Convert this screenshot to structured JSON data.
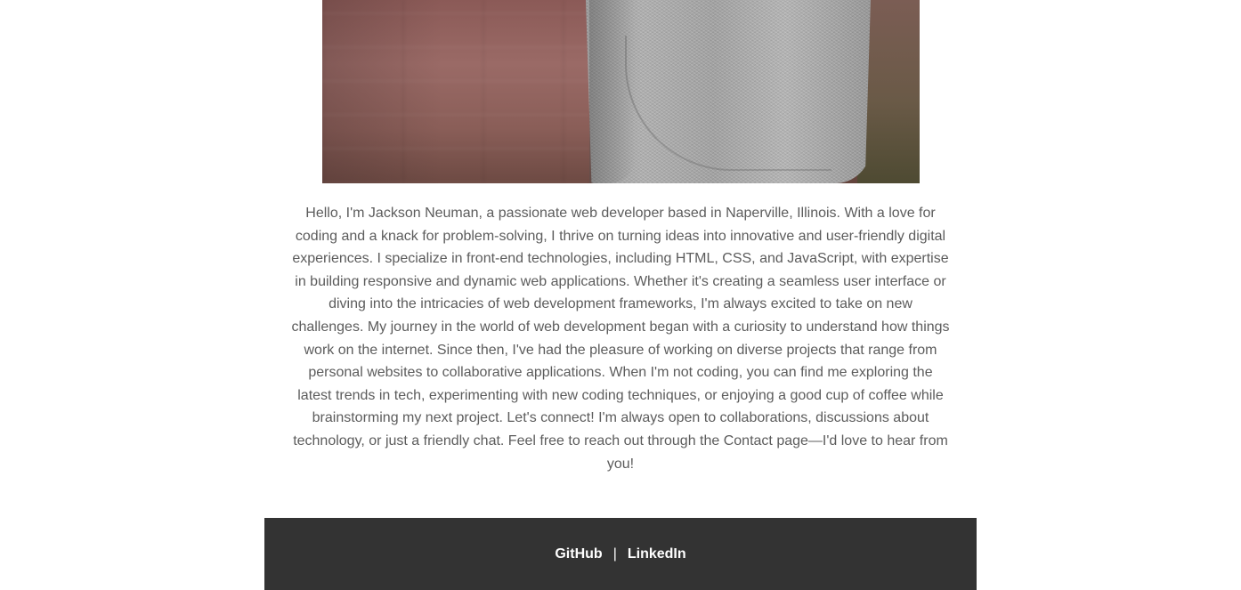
{
  "profile": {
    "photo_alt": "Photo of Jackson Neuman",
    "bio": "Hello, I'm Jackson Neuman, a passionate web developer based in Naperville, Illinois. With a love for coding and a knack for problem-solving, I thrive on turning ideas into innovative and user-friendly digital experiences. I specialize in front-end technologies, including HTML, CSS, and JavaScript, with expertise in building responsive and dynamic web applications. Whether it's creating a seamless user interface or diving into the intricacies of web development frameworks, I'm always excited to take on new challenges. My journey in the world of web development began with a curiosity to understand how things work on the internet. Since then, I've had the pleasure of working on diverse projects that range from personal websites to collaborative applications. When I'm not coding, you can find me exploring the latest trends in tech, experimenting with new coding techniques, or enjoying a good cup of coffee while brainstorming my next project. Let's connect! I'm always open to collaborations, discussions about technology, or just a friendly chat. Feel free to reach out through the Contact page—I'd love to hear from you!"
  },
  "footer": {
    "links": [
      {
        "label": "GitHub"
      },
      {
        "label": "LinkedIn"
      }
    ],
    "separator": "|"
  },
  "colors": {
    "footer_bg": "#333333",
    "bio_text": "#5c5c5c",
    "footer_text": "#ffffff"
  }
}
